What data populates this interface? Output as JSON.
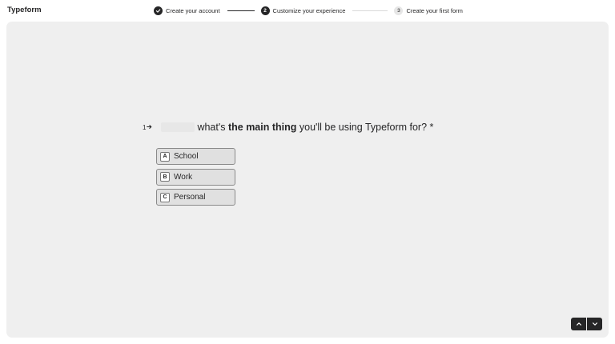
{
  "header": {
    "brand": "Typeform",
    "steps": [
      {
        "number": "",
        "label": "Create your account",
        "state": "done"
      },
      {
        "number": "2",
        "label": "Customize your experience",
        "state": "active"
      },
      {
        "number": "3",
        "label": "Create your first form",
        "state": "todo"
      }
    ]
  },
  "question": {
    "number": "1",
    "text_before": "what's ",
    "text_bold": "the main thing",
    "text_after": " you'll be using Typeform for? *",
    "choices": [
      {
        "key": "A",
        "label": "School"
      },
      {
        "key": "B",
        "label": "Work"
      },
      {
        "key": "C",
        "label": "Personal"
      }
    ]
  },
  "icons": {
    "done_step": "check-icon",
    "arrow": "arrow-right-icon",
    "nav_up": "chevron-up-icon",
    "nav_down": "chevron-down-icon"
  },
  "colors": {
    "dark": "#262627",
    "panel": "#efefef",
    "choice_bg": "#e0e0e0"
  }
}
